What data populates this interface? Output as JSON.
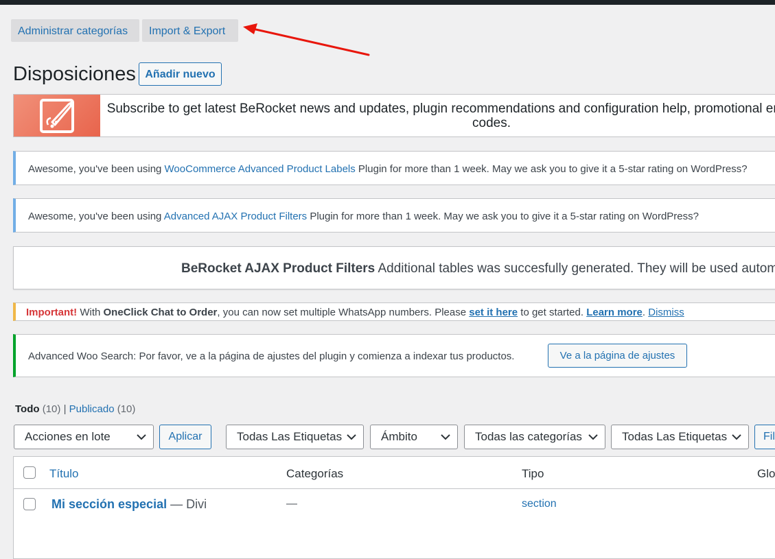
{
  "subnav": {
    "manage_categories": "Administrar categorías",
    "import_export": "Import & Export"
  },
  "page": {
    "title": "Disposiciones",
    "add_new": "Añadir nuevo"
  },
  "banner": {
    "text": "Subscribe to get latest BeRocket news and updates, plugin recommendations and configuration help, promotional email with discount codes."
  },
  "notices": {
    "labels": {
      "prefix": "Awesome, you've been using ",
      "plugin": "WooCommerce Advanced Product Labels",
      "suffix": " Plugin for more than 1 week. May we ask you to give it a 5-star rating on WordPress?"
    },
    "filters": {
      "prefix": "Awesome, you've been using ",
      "plugin": "Advanced AJAX Product Filters",
      "suffix": " Plugin for more than 1 week. May we ask you to give it a 5-star rating on WordPress?"
    },
    "tables": {
      "bold": "BeRocket AJAX Product Filters",
      "rest": " Additional tables was succesfully generated. They will be used automatically."
    },
    "whatsapp": {
      "important": "Important!",
      "with": " With ",
      "product": "OneClick Chat to Order",
      "mid": ", you can now set multiple WhatsApp numbers. Please ",
      "set_link": "set it here",
      "after": " to get started. ",
      "learn_more": "Learn more",
      "dot": ". ",
      "dismiss": "Dismiss"
    },
    "search": {
      "text": "Advanced Woo Search: Por favor, ve a la página de ajustes del plugin y comienza a indexar tus productos.",
      "button": "Ve a la página de ajustes"
    }
  },
  "views": {
    "all": "Todo",
    "all_count": "(10)",
    "separator": "|",
    "published": "Publicado",
    "published_count": "(10)"
  },
  "filters": {
    "bulk_actions": "Acciones en lote",
    "apply": "Aplicar",
    "tags_1": "Todas Las Etiquetas",
    "scope": "Ámbito",
    "categories": "Todas las categorías",
    "tags_2": "Todas Las Etiquetas",
    "filter_button": "Filtrar"
  },
  "table": {
    "columns": {
      "title": "Título",
      "categories": "Categorías",
      "type": "Tipo",
      "global": "Global"
    },
    "rows": [
      {
        "title": "Mi sección especial",
        "state": " — Divi",
        "categories": "—",
        "type": "section"
      }
    ]
  },
  "colors": {
    "link": "#2271b1",
    "annotation_arrow": "#e8160c",
    "notice_info": "#72aee6",
    "notice_warning": "#f0b849",
    "notice_success": "#00a32a"
  }
}
